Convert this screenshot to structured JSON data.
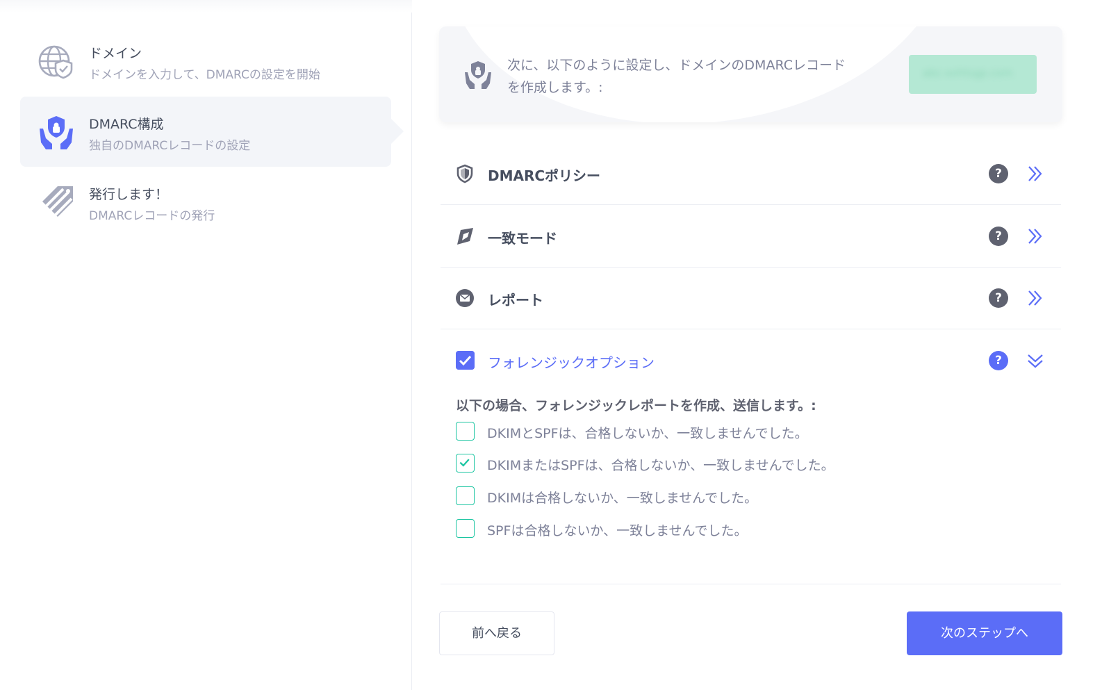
{
  "sidebar": {
    "steps": [
      {
        "title": "ドメイン",
        "desc": "ドメインを入力して、DMARCの設定を開始",
        "icon": "globe-shield-icon",
        "active": false
      },
      {
        "title": "DMARC構成",
        "desc": "独自のDMARCレコードの設定",
        "icon": "hands-shield-icon",
        "active": true
      },
      {
        "title": "発行します！",
        "desc": "DMARCレコードの発行",
        "icon": "tag-stripes-icon",
        "active": false
      }
    ]
  },
  "banner": {
    "text": "次に、以下のように設定し、ドメインのDMARCレコードを作成します。:",
    "domain": "abc-xxhtsgp.com"
  },
  "accordion": [
    {
      "title": "DMARCポリシー",
      "icon": "shield-icon",
      "help": "?"
    },
    {
      "title": "一致モード",
      "icon": "compass-icon",
      "help": "?"
    },
    {
      "title": "レポート",
      "icon": "envelope-icon",
      "help": "?"
    }
  ],
  "forensic": {
    "title": "フォレンジックオプション",
    "help": "?",
    "heading": "以下の場合、フォレンジックレポートを作成、送信します。:",
    "options": [
      {
        "label": "DKIMとSPFは、合格しないか、一致しませんでした。",
        "checked": false
      },
      {
        "label": "DKIMまたはSPFは、合格しないか、一致しませんでした。",
        "checked": true
      },
      {
        "label": "DKIMは合格しないか、一致しませんでした。",
        "checked": false
      },
      {
        "label": "SPFは合格しないか、一致しませんでした。",
        "checked": false
      }
    ]
  },
  "buttons": {
    "back": "前へ戻る",
    "next": "次のステップへ"
  },
  "colors": {
    "accent": "#5b6df7",
    "success": "#1bc5a1",
    "muted": "#a0a3b7",
    "chip": "#b4e8d4"
  }
}
